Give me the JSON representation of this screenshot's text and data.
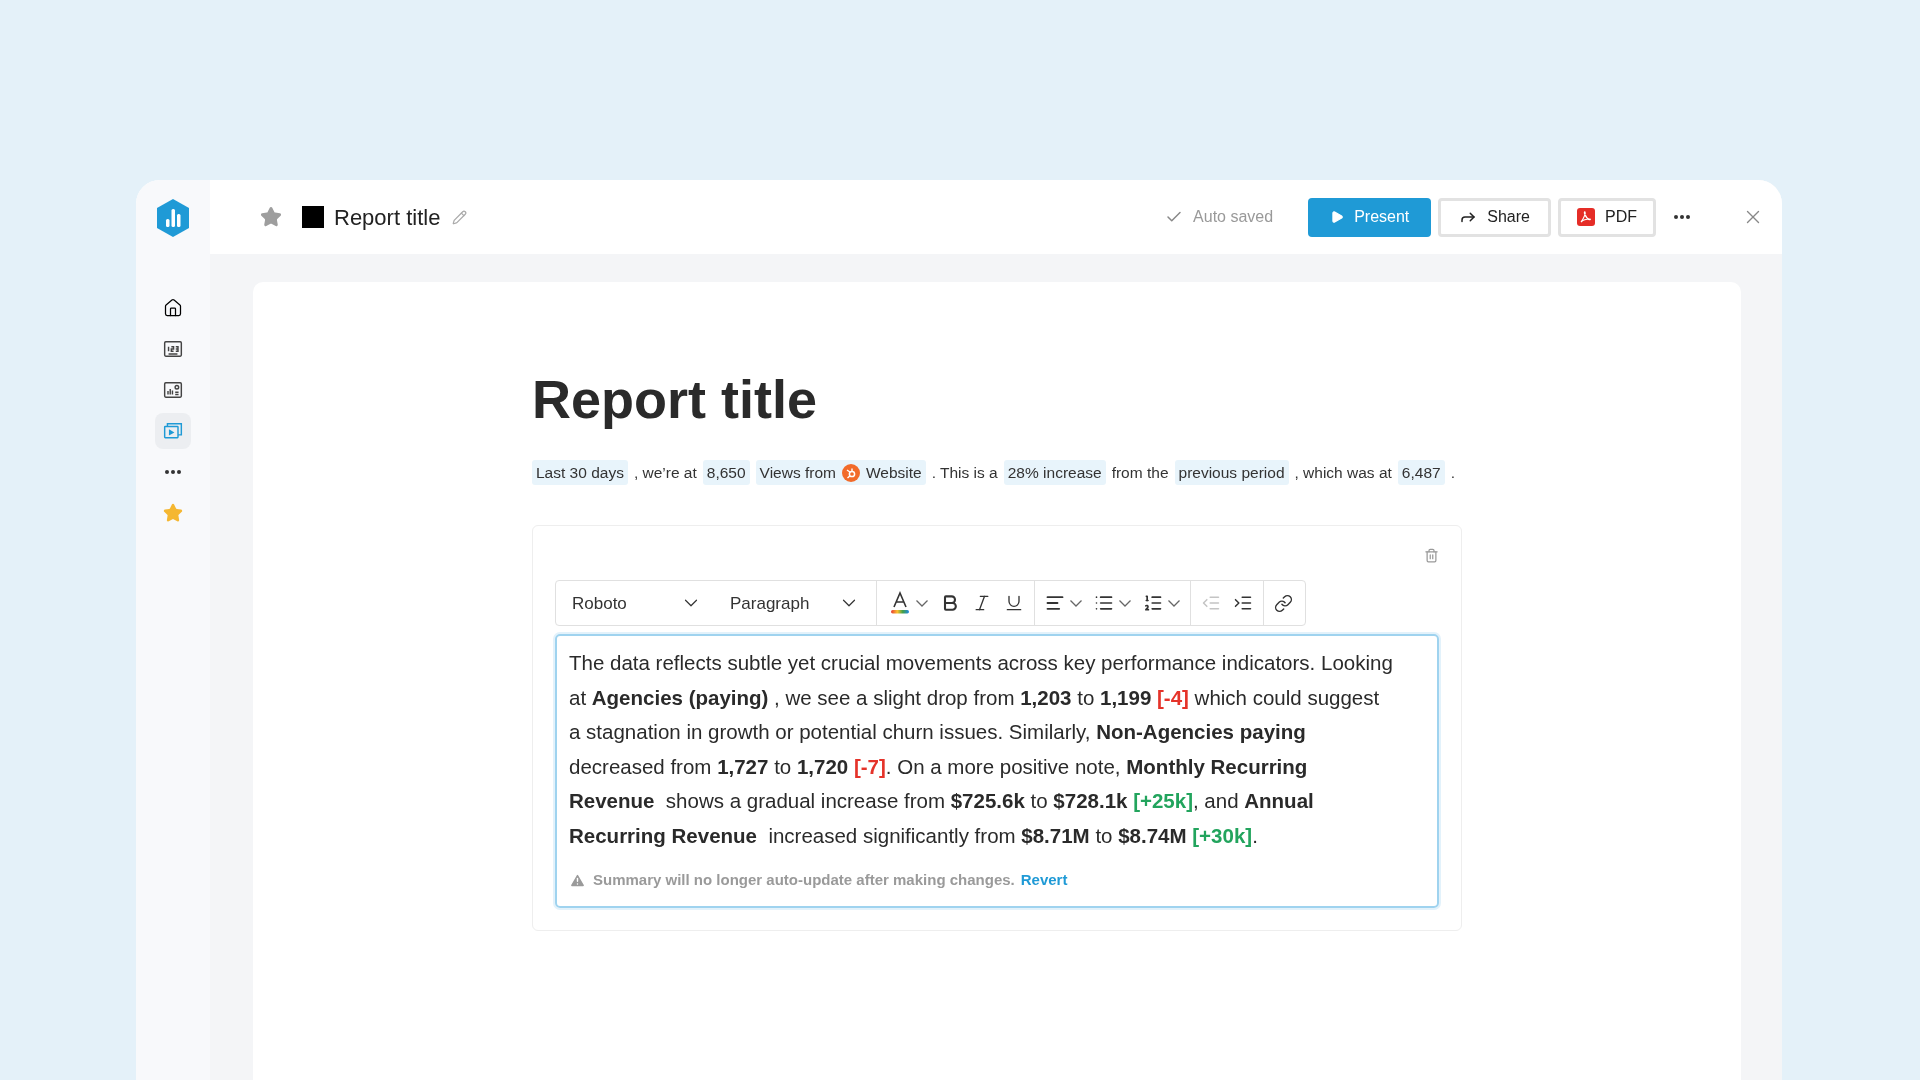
{
  "sidebar": {
    "items": [
      {
        "selected": false
      },
      {
        "selected": false
      },
      {
        "selected": false
      },
      {
        "selected": true
      },
      {
        "selected": false
      },
      {
        "selected": false
      }
    ]
  },
  "header": {
    "starred": false,
    "title": "Report title",
    "status": "Auto saved",
    "buttons": [
      {
        "kind": "primary",
        "label": "Present"
      },
      {
        "kind": "share",
        "label": "Share"
      },
      {
        "kind": "pdf",
        "label": "PDF"
      }
    ]
  },
  "report": {
    "title": "Report title",
    "summary": [
      {
        "kind": "chip",
        "text": "Last 30 days"
      },
      {
        "kind": "text",
        "text": ", we’re at"
      },
      {
        "kind": "chip",
        "text": "8,650"
      },
      {
        "kind": "source",
        "text": "Views from",
        "source": "Website"
      },
      {
        "kind": "text",
        "text": ". This is a"
      },
      {
        "kind": "chip",
        "text": "28% increase"
      },
      {
        "kind": "text",
        "text": "from the"
      },
      {
        "kind": "chip",
        "text": "previous period"
      },
      {
        "kind": "text",
        "text": ", which was at"
      },
      {
        "kind": "chip",
        "text": "6,487"
      },
      {
        "kind": "text",
        "text": "."
      }
    ]
  },
  "editor": {
    "font": "Roboto",
    "block_style": "Paragraph",
    "outdent": {
      "disabled": true
    },
    "indent": {
      "disabled": false
    },
    "paragraph": [
      {
        "kind": "plain",
        "text": "The data reflects subtle yet crucial movements across key performance indicators. Looking at "
      },
      {
        "kind": "bold",
        "text": "Agencies (paying)"
      },
      {
        "kind": "plain",
        "text": " , we see a slight drop from "
      },
      {
        "kind": "bold",
        "text": "1,203"
      },
      {
        "kind": "plain",
        "text": " to "
      },
      {
        "kind": "bold",
        "text": "1,199"
      },
      {
        "kind": "down",
        "text": " [-4]"
      },
      {
        "kind": "plain",
        "text": " which could suggest a stagnation in growth or potential churn issues. Similarly, "
      },
      {
        "kind": "bold",
        "text": "Non-Agencies paying"
      },
      {
        "kind": "plain",
        "text": "  decreased from "
      },
      {
        "kind": "bold",
        "text": "1,727"
      },
      {
        "kind": "plain",
        "text": " to "
      },
      {
        "kind": "bold",
        "text": "1,720"
      },
      {
        "kind": "down",
        "text": " [-7]"
      },
      {
        "kind": "plain",
        "text": ". On a more positive note, "
      },
      {
        "kind": "bold",
        "text": "Monthly Recurring Revenue"
      },
      {
        "kind": "plain",
        "text": "  shows a gradual increase from "
      },
      {
        "kind": "bold",
        "text": "$725.6k"
      },
      {
        "kind": "plain",
        "text": " to "
      },
      {
        "kind": "bold",
        "text": "$728.1k"
      },
      {
        "kind": "up",
        "text": " [+25k]"
      },
      {
        "kind": "plain",
        "text": ", and "
      },
      {
        "kind": "bold",
        "text": "Annual Recurring Revenue"
      },
      {
        "kind": "plain",
        "text": "  increased significantly from "
      },
      {
        "kind": "bold",
        "text": "$8.71M"
      },
      {
        "kind": "plain",
        "text": " to "
      },
      {
        "kind": "bold",
        "text": "$8.74M"
      },
      {
        "kind": "up",
        "text": " [+30k]"
      },
      {
        "kind": "plain",
        "text": "."
      }
    ],
    "notice": "Summary will no longer auto-update after making changes.",
    "revert": "Revert"
  }
}
